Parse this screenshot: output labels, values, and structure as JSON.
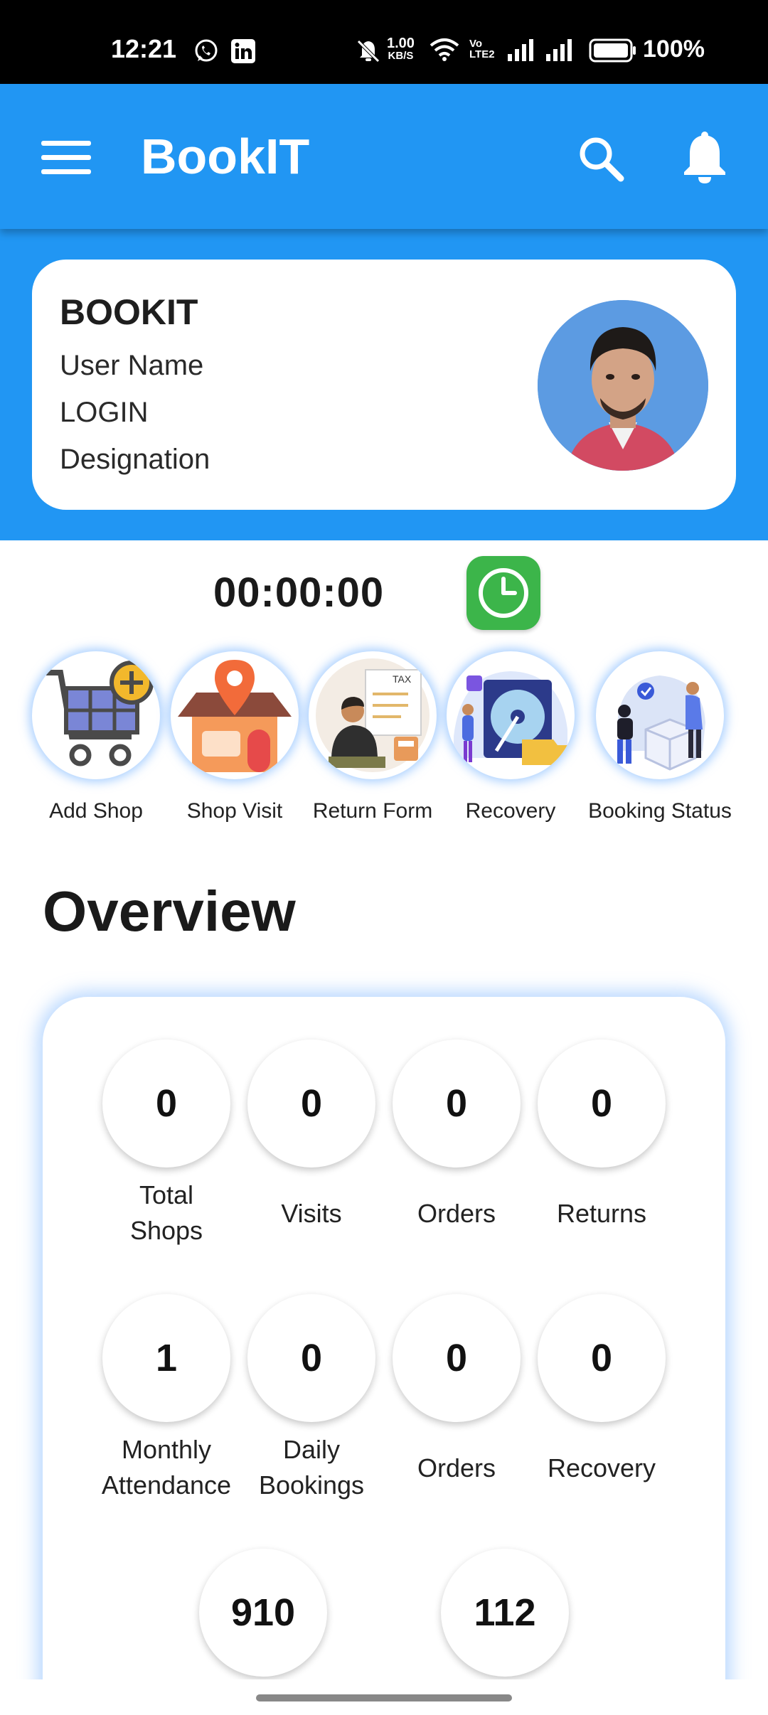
{
  "status_bar": {
    "time": "12:21",
    "net_speed_value": "1.00",
    "net_speed_unit": "KB/S",
    "battery_text": "100%",
    "icons": [
      "whatsapp-icon",
      "linkedin-icon",
      "mute-icon",
      "wifi-icon",
      "volte-icon",
      "signal-icon",
      "signal-icon",
      "battery-icon"
    ]
  },
  "app_bar": {
    "title": "BookIT",
    "icons": [
      "menu-icon",
      "search-icon",
      "bell-icon"
    ],
    "color": "#2196f3"
  },
  "profile": {
    "company": "BOOKIT",
    "user_name": "User Name",
    "login": "LOGIN",
    "designation": "Designation"
  },
  "timer": {
    "value": "00:00:00",
    "button_icon": "clock-icon",
    "button_color": "#3cb54a"
  },
  "quick_actions": [
    {
      "label": "Add Shop",
      "icon": "add-shop-icon"
    },
    {
      "label": "Shop Visit",
      "icon": "shop-visit-icon"
    },
    {
      "label": "Return Form",
      "icon": "return-form-icon"
    },
    {
      "label": "Recovery",
      "icon": "recovery-icon"
    },
    {
      "label": "Booking Status",
      "icon": "booking-status-icon"
    }
  ],
  "overview": {
    "title": "Overview",
    "stats": [
      {
        "value": "0",
        "label_line1": "Total",
        "label_line2": "Shops"
      },
      {
        "value": "0",
        "label_line1": "Visits",
        "label_line2": ""
      },
      {
        "value": "0",
        "label_line1": "Orders",
        "label_line2": ""
      },
      {
        "value": "0",
        "label_line1": "Returns",
        "label_line2": ""
      },
      {
        "value": "1",
        "label_line1": "Monthly",
        "label_line2": "Attendance"
      },
      {
        "value": "0",
        "label_line1": "Daily",
        "label_line2": "Bookings"
      },
      {
        "value": "0",
        "label_line1": "Orders",
        "label_line2": ""
      },
      {
        "value": "0",
        "label_line1": "Recovery",
        "label_line2": ""
      },
      {
        "value": "910",
        "label_line1": "",
        "label_line2": ""
      },
      {
        "value": "112",
        "label_line1": "",
        "label_line2": ""
      }
    ]
  }
}
